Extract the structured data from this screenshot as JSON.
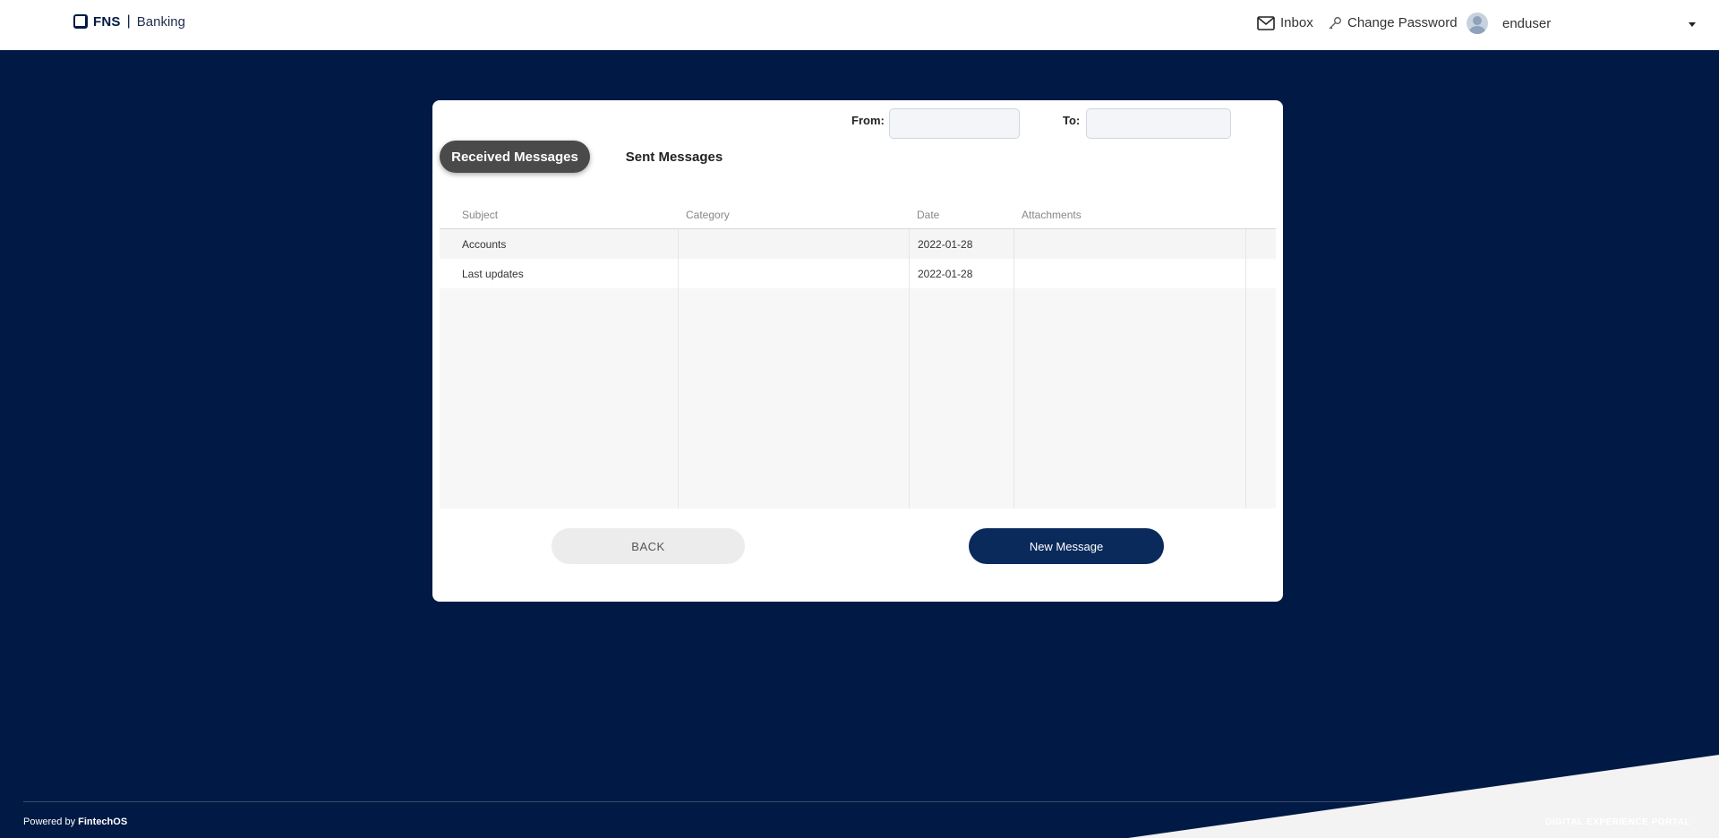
{
  "header": {
    "brand_name": "FNS",
    "brand_separator": "|",
    "brand_product": "Banking",
    "nav": {
      "inbox": "Inbox",
      "change_password": "Change Password",
      "username": "enduser"
    }
  },
  "filters": {
    "from_label": "From:",
    "to_label": "To:",
    "from_value": "",
    "to_value": ""
  },
  "tabs": [
    {
      "label": "Received Messages",
      "active": true
    },
    {
      "label": "Sent Messages",
      "active": false
    }
  ],
  "table": {
    "columns": [
      "Subject",
      "Category",
      "Date",
      "Attachments"
    ],
    "rows": [
      {
        "subject": "Accounts",
        "category": "",
        "date": "2022-01-28",
        "attachments": ""
      },
      {
        "subject": "Last updates",
        "category": "",
        "date": "2022-01-28",
        "attachments": ""
      }
    ]
  },
  "actions": {
    "back_label": "BACK",
    "new_message_label": "New Message"
  },
  "footer": {
    "powered_prefix": "Powered by",
    "powered_brand": "FintechOS",
    "portal_label": "DIGITAL EXPERIENCE PORTAL"
  },
  "colors": {
    "background": "#001a45",
    "primary_button": "#0a2a5c",
    "active_tab": "#4a4a4a"
  }
}
